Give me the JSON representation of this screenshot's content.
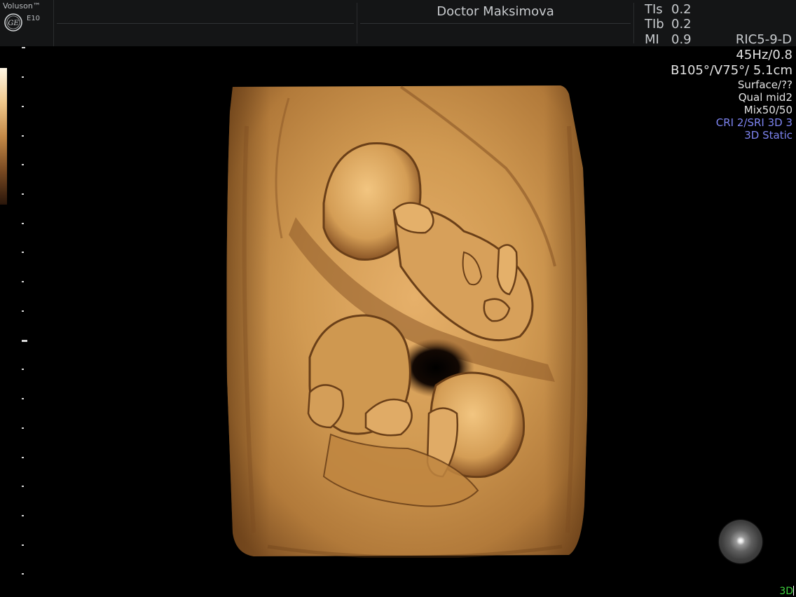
{
  "header": {
    "brand_name": "Voluson™",
    "brand_logo": "ge-logo",
    "brand_model": "E10",
    "operator": "Doctor Maksimova",
    "safety": [
      {
        "label": "TIs",
        "value": "0.2"
      },
      {
        "label": "TIb",
        "value": "0.2"
      },
      {
        "label": "MI",
        "value": "0.9"
      }
    ],
    "probe": "RIC5-9-D"
  },
  "params": {
    "frame_rate": "45Hz/0.8",
    "angles": "B105°/V75°/ 5.1cm",
    "render_mode": "Surface/??",
    "quality": "Qual mid2",
    "mix": "Mix50/50",
    "filters": "CRI 2/SRI 3D 3",
    "acquisition": "3D Static"
  },
  "mode_indicator": "3D",
  "colors": {
    "header_bg": "#141516",
    "text_gray": "#c8cbce",
    "param_blue": "#7d84f0",
    "mode_green": "#3fd23f",
    "sepia_light": "#f0c88c",
    "sepia_dark": "#5a3411"
  },
  "icons": {
    "orientation": "orientation-sphere-icon",
    "brand": "ge-logo-icon"
  }
}
